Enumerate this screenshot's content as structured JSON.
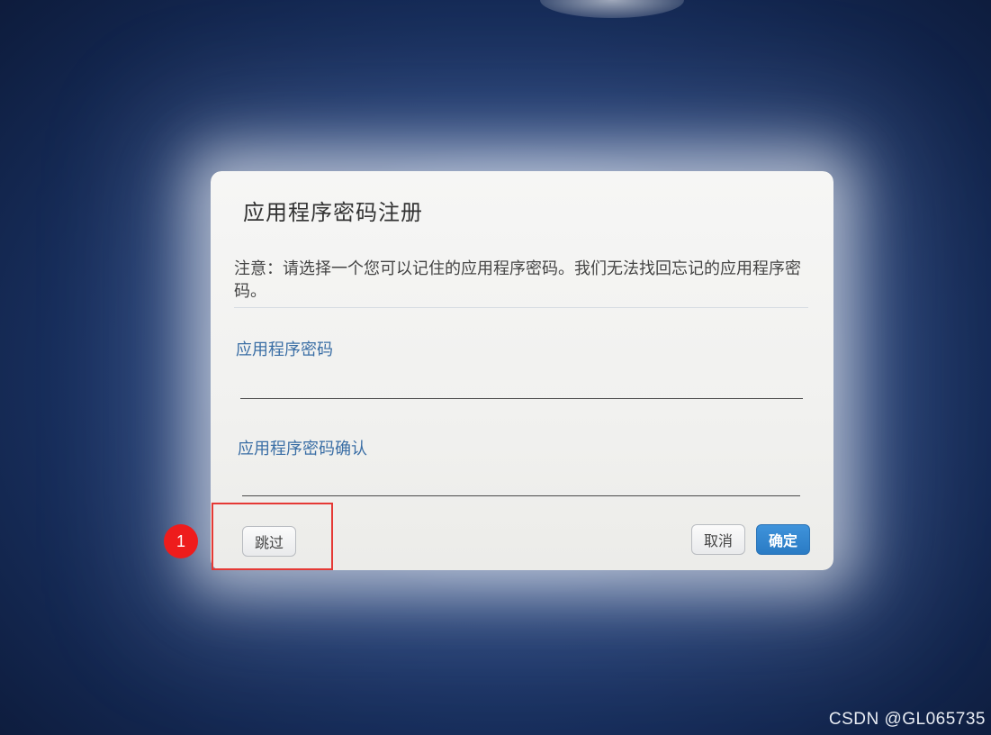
{
  "dialog": {
    "title": "应用程序密码注册",
    "notice": "注意：请选择一个您可以记住的应用程序密码。我们无法找回忘记的应用程序密码。",
    "fields": [
      {
        "label": "应用程序密码",
        "value": ""
      },
      {
        "label": "应用程序密码确认",
        "value": ""
      }
    ],
    "buttons": {
      "skip": "跳过",
      "cancel": "取消",
      "ok": "确定"
    }
  },
  "annotation": {
    "step": "1",
    "highlight_color": "#e53935"
  },
  "watermark": "CSDN @GL065735",
  "colors": {
    "primary_button": "#2a7bc4",
    "field_label": "#3a6ea5"
  }
}
